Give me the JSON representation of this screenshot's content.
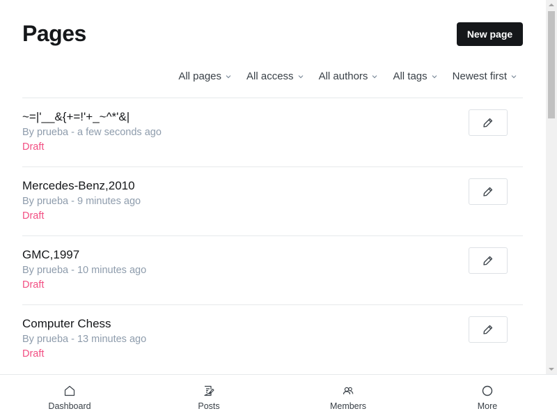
{
  "header": {
    "title": "Pages",
    "new_page_label": "New page"
  },
  "filters": [
    {
      "label": "All pages"
    },
    {
      "label": "All access"
    },
    {
      "label": "All authors"
    },
    {
      "label": "All tags"
    },
    {
      "label": "Newest first"
    }
  ],
  "pages": [
    {
      "title": "~=|'__&{+=!'+_~^*'&|",
      "meta": "By prueba - a few seconds ago",
      "status": "Draft"
    },
    {
      "title": "Mercedes-Benz,2010",
      "meta": "By prueba - 9 minutes ago",
      "status": "Draft"
    },
    {
      "title": "GMC,1997",
      "meta": "By prueba - 10 minutes ago",
      "status": "Draft"
    },
    {
      "title": "Computer Chess",
      "meta": "By prueba - 13 minutes ago",
      "status": "Draft"
    }
  ],
  "bottom_nav": [
    {
      "label": "Dashboard",
      "icon": "home-icon"
    },
    {
      "label": "Posts",
      "icon": "posts-icon"
    },
    {
      "label": "Members",
      "icon": "members-icon"
    },
    {
      "label": "More",
      "icon": "circle-icon"
    }
  ],
  "colors": {
    "accent_draft": "#f24e82",
    "primary_button": "#15171a",
    "meta_text": "#8e9cac"
  }
}
